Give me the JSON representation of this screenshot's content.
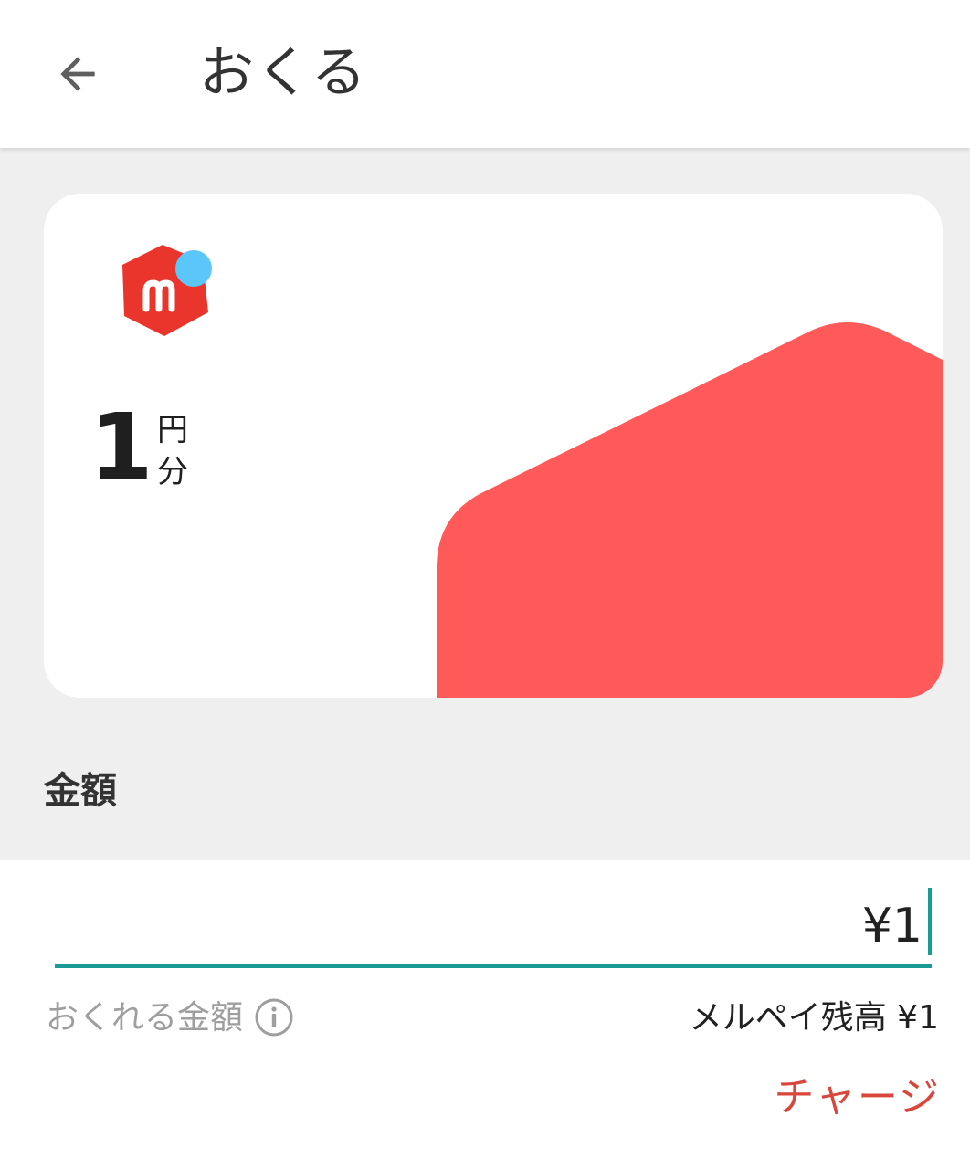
{
  "header": {
    "title": "おくる",
    "back_icon": "arrow-left-icon"
  },
  "card": {
    "amount": "1",
    "unit_line1": "円",
    "unit_line2": "分",
    "brand_color": "#ff5a5a",
    "logo_red": "#ea352d",
    "logo_dot": "#5bc6fa"
  },
  "section": {
    "amount_label": "金額"
  },
  "input": {
    "value": "¥1",
    "accent_color": "#1a9a94"
  },
  "footer": {
    "sendable_label": "おくれる金額",
    "info_icon": "info-circle-icon",
    "balance": "メルペイ残高 ¥1",
    "charge": "チャージ",
    "charge_color": "#d9463c"
  }
}
